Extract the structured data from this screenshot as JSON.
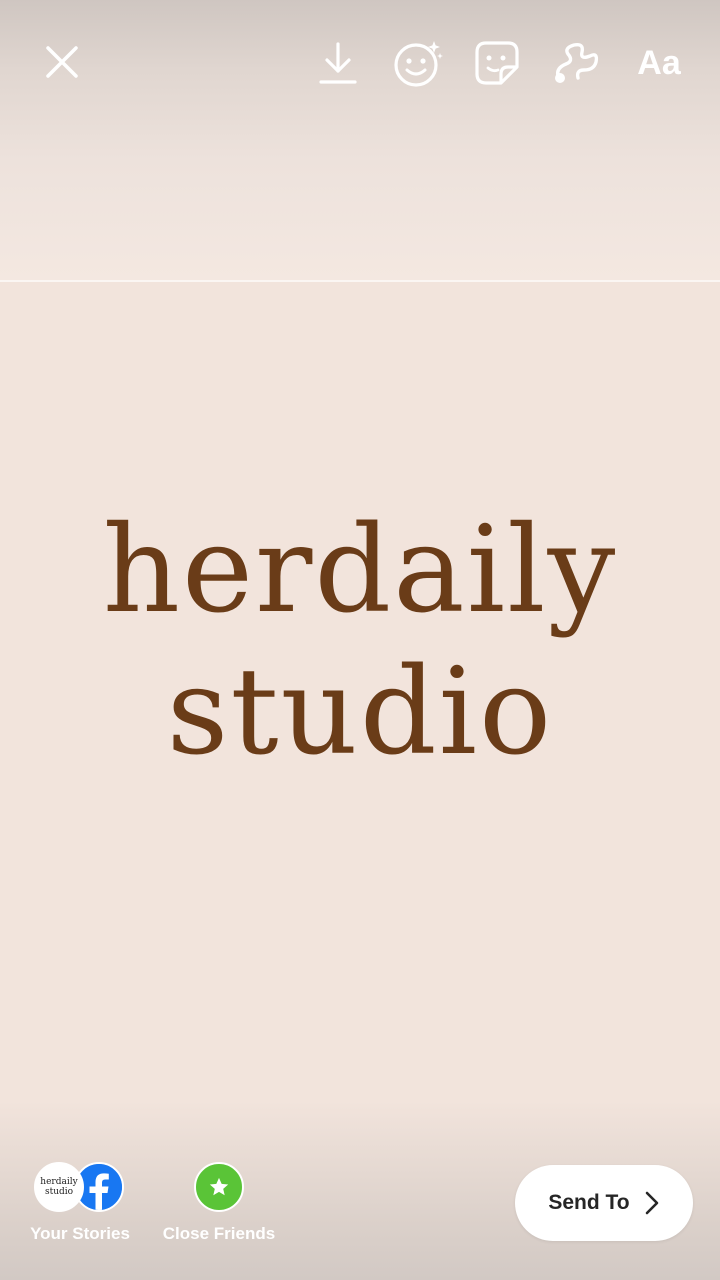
{
  "toolbar": {
    "close_icon": "close-icon",
    "download_icon": "download-icon",
    "effects_icon": "face-effects-icon",
    "sticker_icon": "sticker-icon",
    "draw_icon": "draw-icon",
    "text_tool_label": "Aa"
  },
  "story": {
    "brand_line_1": "herdaily",
    "brand_line_2": "studio",
    "text_color": "#6a3c18",
    "background_color": "#f2e4dc"
  },
  "share": {
    "your_stories": {
      "label": "Your Stories",
      "avatar_line_1": "herdaily",
      "avatar_line_2": "studio"
    },
    "close_friends": {
      "label": "Close Friends",
      "badge_color": "#5ac437"
    },
    "send_to_label": "Send To",
    "facebook_color": "#1877f2"
  }
}
